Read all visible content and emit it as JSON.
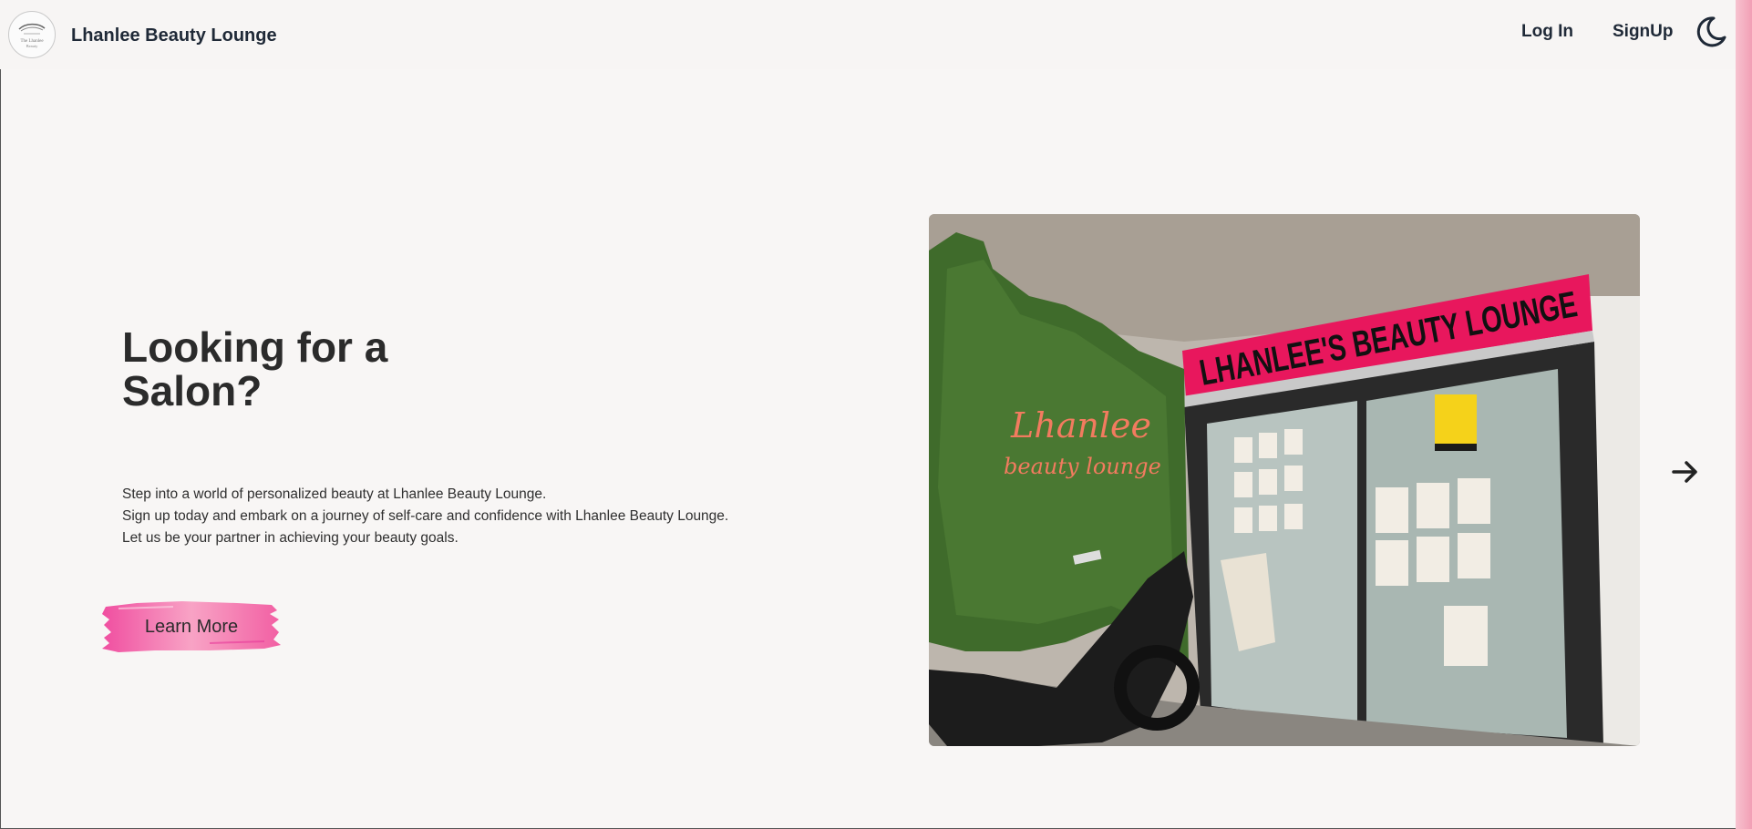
{
  "header": {
    "brand": "Lhanlee Beauty Lounge",
    "logo_icon": "salon-logo-icon",
    "nav": {
      "login_label": "Log In",
      "signup_label": "SignUp"
    },
    "theme_toggle_icon": "moon-icon"
  },
  "hero": {
    "title": "Looking for a Salon?",
    "copy": [
      "Step into a world of personalized beauty at Lhanlee Beauty Lounge.",
      "Sign up today and embark on a journey of self-care and confidence with Lhanlee Beauty Lounge.",
      "Let us be your partner in achieving your beauty goals."
    ],
    "cta_label": "Learn More",
    "cta_color": "#f25fa3"
  },
  "carousel": {
    "image_alt": "Lhanlee's Beauty Lounge storefront",
    "sign_text": "LHANLEE'S BEAUTY LOUNGE",
    "next_icon": "arrow-right-icon"
  },
  "colors": {
    "background": "#f8f6f5",
    "accent": "#f25fa3",
    "scrollbar": "#f4a9bd",
    "sign": "#e8175d"
  }
}
